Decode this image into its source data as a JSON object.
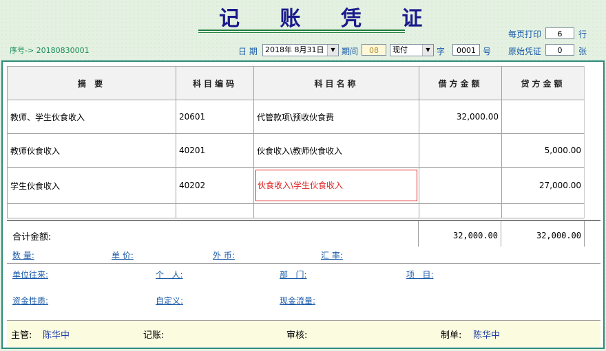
{
  "header": {
    "title": "记 账 凭 证",
    "serial_label": "序号-> 20180830001",
    "per_page_label": "每页打印",
    "per_page_value": "6",
    "per_page_unit": "行",
    "date_label": "日 期",
    "date_value": "2018年 8月31日",
    "period_label": "期间",
    "period_value": "08",
    "type_value": "现付",
    "zi_label": "字",
    "number_value": "0001",
    "hao_label": "号",
    "original_label": "原始凭证",
    "original_value": "0",
    "original_unit": "张"
  },
  "table": {
    "headers": [
      "摘 要",
      "科目编码",
      "科目名称",
      "借方金额",
      "贷方金额"
    ],
    "rows": [
      {
        "summary": "教师、学生伙食收入",
        "code": "20601",
        "name": "代管款项\\预收伙食费",
        "debit": "32,000.00",
        "credit": ""
      },
      {
        "summary": "教师伙食收入",
        "code": "40201",
        "name": "伙食收入\\教师伙食收入",
        "debit": "",
        "credit": "5,000.00"
      },
      {
        "summary": "学生伙食收入",
        "code": "40202",
        "name": "伙食收入\\学生伙食收入",
        "debit": "",
        "credit": "27,000.00"
      }
    ],
    "total_label": "合计金额:",
    "total_debit": "32,000.00",
    "total_credit": "32,000.00"
  },
  "details": {
    "qty": "数 量:",
    "price": "单 价:",
    "fx": "外 币:",
    "rate": "汇 率:",
    "unit": "单位往来:",
    "person": "个   人:",
    "dept": "部   门:",
    "project": "项   目:",
    "fund": "资金性质:",
    "custom": "自定义:",
    "cashflow": "现金流量:"
  },
  "footer": {
    "supervisor_label": "主管:",
    "supervisor_value": "陈华中",
    "bookkeeper_label": "记账:",
    "auditor_label": "审核:",
    "maker_label": "制单:",
    "maker_value": "陈华中"
  },
  "colors": {
    "title": "#1a1a8c",
    "label": "#1a5aa8",
    "highlight": "#e02020",
    "frame": "#2e8a7a"
  }
}
